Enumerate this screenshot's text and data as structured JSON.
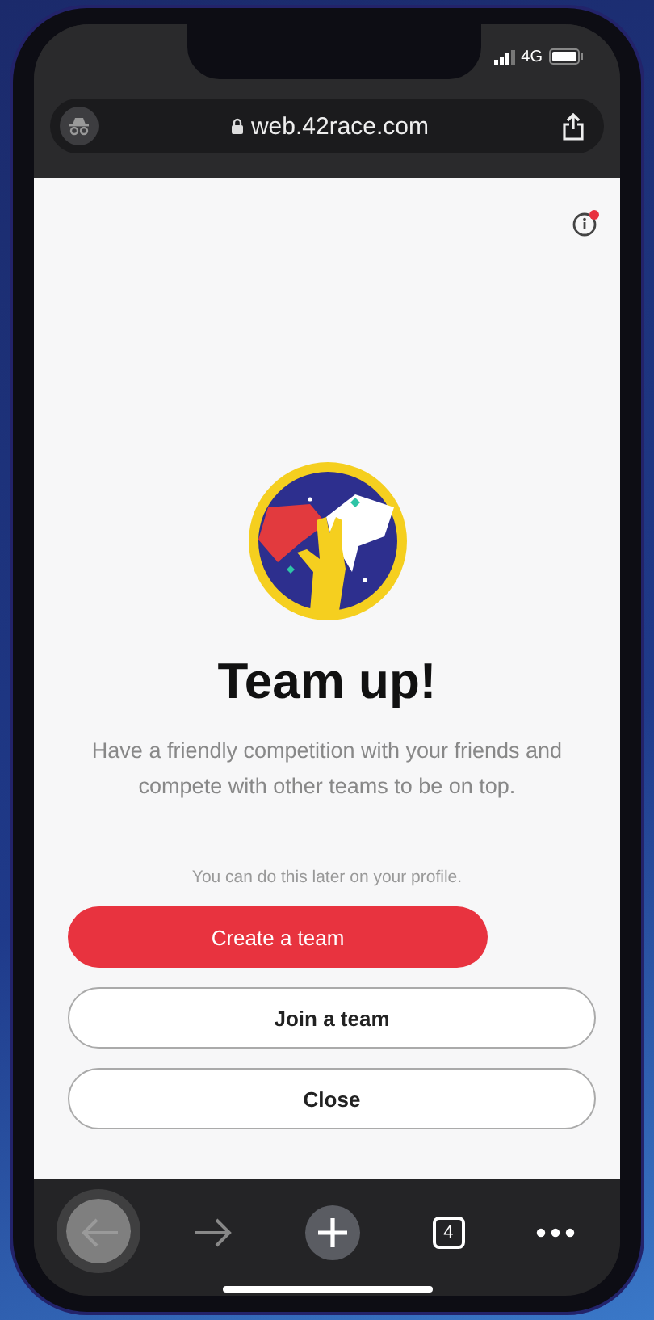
{
  "status_bar": {
    "network": "4G"
  },
  "address_bar": {
    "url": "web.42race.com"
  },
  "page": {
    "title": "Team up!",
    "description": "Have a friendly competition with your friends and compete with other teams to be on top.",
    "note": "You can do this later on your profile.",
    "buttons": [
      {
        "label": "Create a team",
        "kind": "primary"
      },
      {
        "label": "Join a team",
        "kind": "outline"
      },
      {
        "label": "Close",
        "kind": "outline"
      }
    ]
  },
  "toolbar": {
    "tab_count": "4"
  }
}
